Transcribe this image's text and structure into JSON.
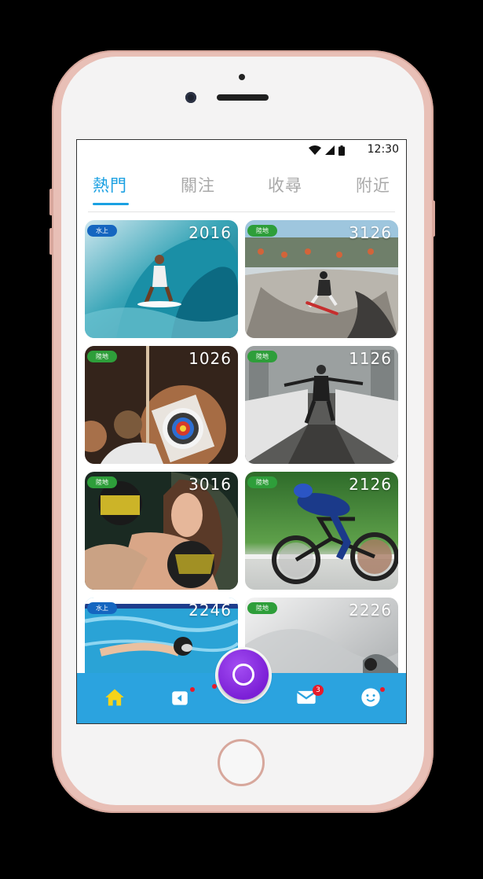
{
  "status_bar": {
    "time": "12:30",
    "icons": [
      "wifi-icon",
      "signal-icon",
      "battery-icon"
    ]
  },
  "tabs": [
    {
      "label": "熱門",
      "active": true
    },
    {
      "label": "關注",
      "active": false
    },
    {
      "label": "收尋",
      "active": false
    },
    {
      "label": "附近",
      "active": false
    }
  ],
  "cards": [
    {
      "tag": "水上",
      "count": "2016",
      "scene": "surfing"
    },
    {
      "tag": "陸地",
      "count": "3126",
      "scene": "skateboarding"
    },
    {
      "tag": "陸地",
      "count": "1026",
      "scene": "archery"
    },
    {
      "tag": "陸地",
      "count": "1126",
      "scene": "jumping"
    },
    {
      "tag": "陸地",
      "count": "3016",
      "scene": "boxing"
    },
    {
      "tag": "陸地",
      "count": "2126",
      "scene": "cycling"
    },
    {
      "tag": "水上",
      "count": "2246",
      "scene": "swimming"
    },
    {
      "tag": "陸地",
      "count": "2226",
      "scene": "snow"
    }
  ],
  "bottom_nav": {
    "items": [
      "home-icon",
      "video-icon",
      "center-button",
      "mail-icon",
      "smiley-icon"
    ],
    "mail_badge": "3"
  },
  "colors": {
    "accent": "#1aa0e2",
    "nav_bg": "#2ba3df",
    "water_tag": "#1566c0",
    "land_tag": "#2e9e3a",
    "home_icon": "#f6d31a",
    "fab": "#8a2be2"
  }
}
